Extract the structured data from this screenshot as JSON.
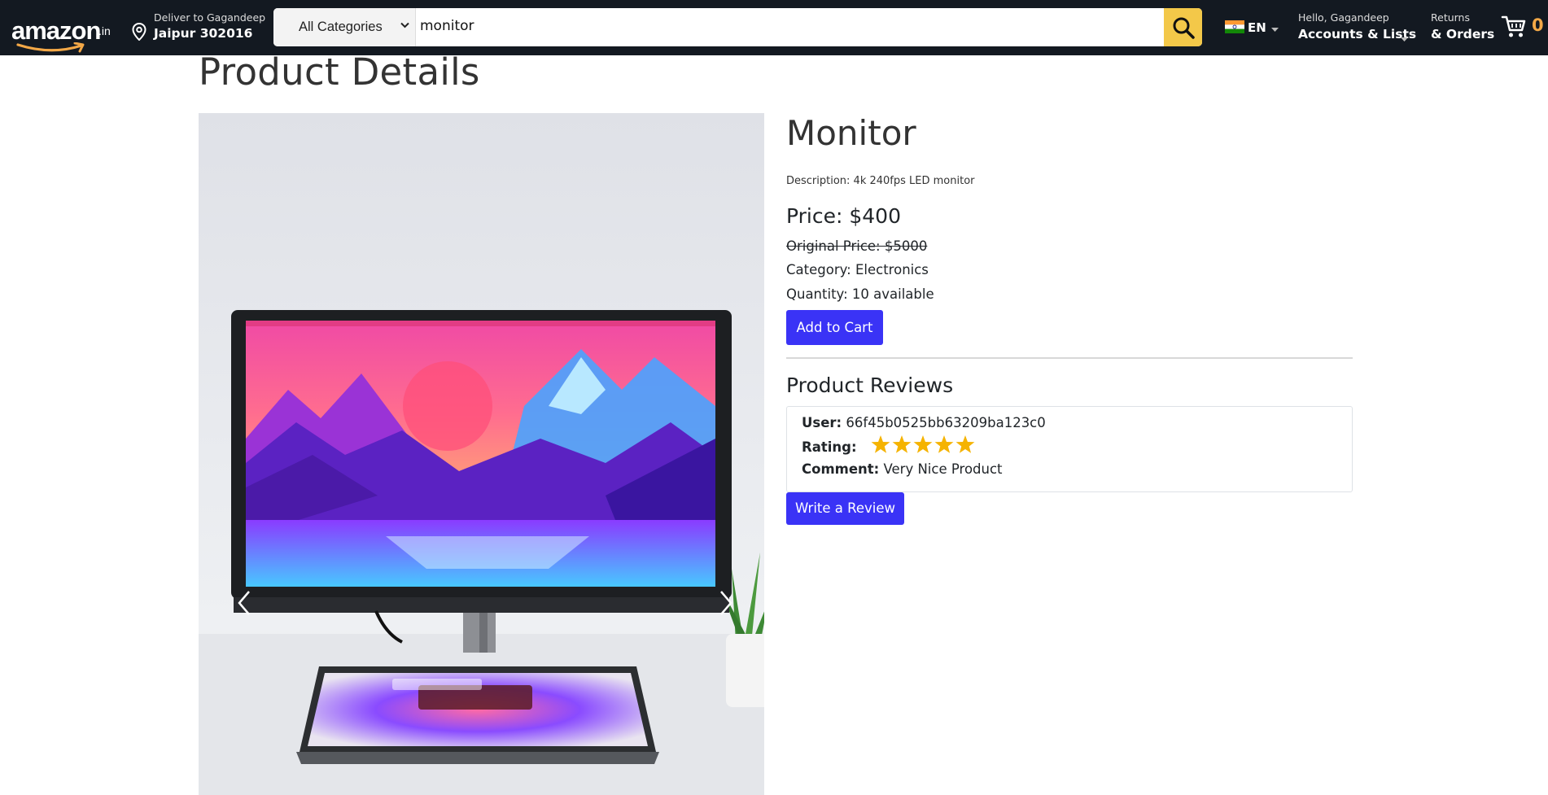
{
  "navbar": {
    "logo": {
      "word": "amazon",
      "tld": ".in"
    },
    "deliver": {
      "line1": "Deliver to Gagandeep",
      "line2": "Jaipur 302016"
    },
    "search": {
      "category": "All Categories",
      "query": "monitor"
    },
    "language": {
      "code": "EN"
    },
    "account": {
      "greeting": "Hello, Gagandeep",
      "label": "Accounts & Lists"
    },
    "orders": {
      "line1": "Returns",
      "line2": "& Orders"
    },
    "cart": {
      "count": "0"
    },
    "colors": {
      "background": "#131921",
      "search_button": "#f3c849",
      "cart_count": "#f3a847"
    }
  },
  "page": {
    "title": "Product Details"
  },
  "product": {
    "name": "Monitor",
    "description": "Description: 4k 240fps LED monitor",
    "price": "Price: $400",
    "original_price": "Original Price: $5000",
    "category": "Category: Electronics",
    "quantity": "Quantity: 10 available",
    "add_to_cart_label": "Add to Cart"
  },
  "reviews": {
    "title": "Product Reviews",
    "items": [
      {
        "user_label": "User:",
        "user": "66f45b0525bb63209ba123c0",
        "rating_label": "Rating:",
        "rating": 5,
        "rating_max": 5,
        "comment_label": "Comment:",
        "comment": "Very Nice Product"
      }
    ],
    "write_review_label": "Write a Review"
  },
  "colors": {
    "primary_button": "#3a33f6",
    "star": "#f5b301"
  }
}
